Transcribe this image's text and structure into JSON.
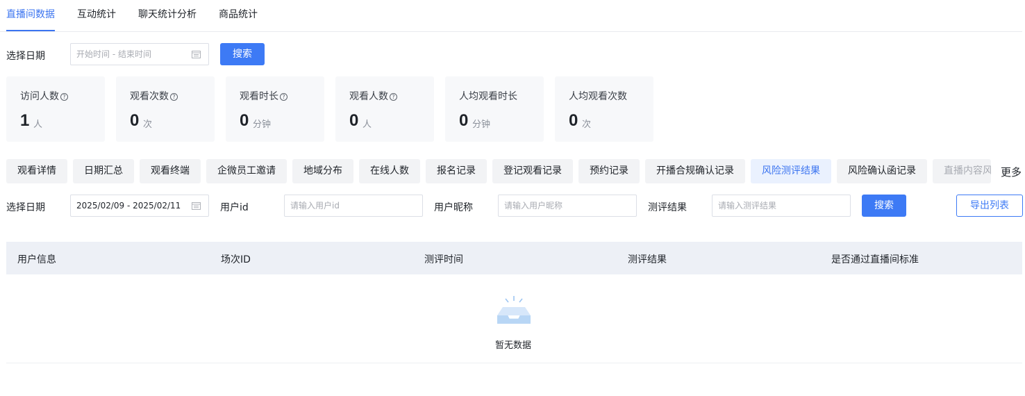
{
  "top_tabs": [
    {
      "label": "直播间数据",
      "active": true
    },
    {
      "label": "互动统计",
      "active": false
    },
    {
      "label": "聊天统计分析",
      "active": false
    },
    {
      "label": "商品统计",
      "active": false
    }
  ],
  "filter1": {
    "date_label": "选择日期",
    "date_placeholder": "开始时间 - 结束时间",
    "search_label": "搜索"
  },
  "stats": [
    {
      "title": "访问人数",
      "has_help": true,
      "value": "1",
      "unit": "人"
    },
    {
      "title": "观看次数",
      "has_help": true,
      "value": "0",
      "unit": "次"
    },
    {
      "title": "观看时长",
      "has_help": true,
      "value": "0",
      "unit": "分钟"
    },
    {
      "title": "观看人数",
      "has_help": true,
      "value": "0",
      "unit": "人"
    },
    {
      "title": "人均观看时长",
      "has_help": false,
      "value": "0",
      "unit": "分钟"
    },
    {
      "title": "人均观看次数",
      "has_help": false,
      "value": "0",
      "unit": "次"
    }
  ],
  "help_glyph": "?",
  "sub_tabs": [
    {
      "label": "观看详情"
    },
    {
      "label": "日期汇总"
    },
    {
      "label": "观看终端"
    },
    {
      "label": "企微员工邀请"
    },
    {
      "label": "地域分布"
    },
    {
      "label": "在线人数"
    },
    {
      "label": "报名记录"
    },
    {
      "label": "登记观看记录"
    },
    {
      "label": "预约记录"
    },
    {
      "label": "开播合规确认记录"
    },
    {
      "label": "风险测评结果",
      "active": true
    },
    {
      "label": "风险确认函记录"
    },
    {
      "label": "直播内容风"
    }
  ],
  "more_label": "更多",
  "filter2": {
    "date_label": "选择日期",
    "date_value": "2025/02/09 - 2025/02/11",
    "user_id_label": "用户id",
    "user_id_placeholder": "请输入用户id",
    "nickname_label": "用户昵称",
    "nickname_placeholder": "请输入用户昵称",
    "result_label": "测评结果",
    "result_placeholder": "请输入测评结果",
    "search_label": "搜索",
    "export_label": "导出列表"
  },
  "table": {
    "columns": [
      "用户信息",
      "场次ID",
      "测评时间",
      "测评结果",
      "是否通过直播间标准"
    ],
    "empty_text": "暂无数据"
  },
  "colors": {
    "primary": "#3d7af5",
    "active_tab_bg": "#eaf1fe",
    "card_bg": "#f7f8fa",
    "table_header_bg": "#edf0f6"
  }
}
